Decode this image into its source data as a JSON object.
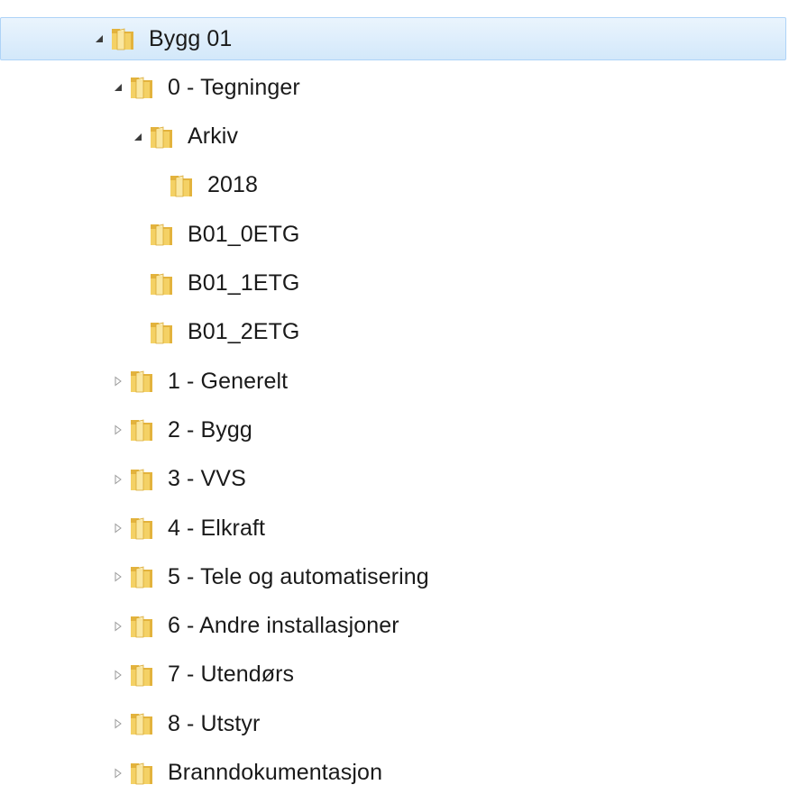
{
  "tree": {
    "items": [
      {
        "label": "Bygg 01",
        "depth": 0,
        "toggle": "expanded",
        "selected": true
      },
      {
        "label": "0 - Tegninger",
        "depth": 1,
        "toggle": "expanded",
        "selected": false
      },
      {
        "label": "Arkiv",
        "depth": 2,
        "toggle": "expanded",
        "selected": false
      },
      {
        "label": "2018",
        "depth": 3,
        "toggle": "none",
        "selected": false
      },
      {
        "label": "B01_0ETG",
        "depth": 2,
        "toggle": "none",
        "selected": false
      },
      {
        "label": "B01_1ETG",
        "depth": 2,
        "toggle": "none",
        "selected": false
      },
      {
        "label": "B01_2ETG",
        "depth": 2,
        "toggle": "none",
        "selected": false
      },
      {
        "label": "1 - Generelt",
        "depth": 1,
        "toggle": "collapsed",
        "selected": false
      },
      {
        "label": "2 - Bygg",
        "depth": 1,
        "toggle": "collapsed",
        "selected": false
      },
      {
        "label": "3 - VVS",
        "depth": 1,
        "toggle": "collapsed",
        "selected": false
      },
      {
        "label": "4 - Elkraft",
        "depth": 1,
        "toggle": "collapsed",
        "selected": false
      },
      {
        "label": "5 - Tele og automatisering",
        "depth": 1,
        "toggle": "collapsed",
        "selected": false
      },
      {
        "label": "6 - Andre installasjoner",
        "depth": 1,
        "toggle": "collapsed",
        "selected": false
      },
      {
        "label": "7 - Utendørs",
        "depth": 1,
        "toggle": "collapsed",
        "selected": false
      },
      {
        "label": "8 - Utstyr",
        "depth": 1,
        "toggle": "collapsed",
        "selected": false
      },
      {
        "label": "Branndokumentasjon",
        "depth": 1,
        "toggle": "collapsed",
        "selected": false
      }
    ]
  },
  "icons": {
    "folder": "folder-icon",
    "expanded": "triangle-expanded-icon",
    "collapsed": "triangle-collapsed-icon"
  },
  "colors": {
    "selection_top": "#eaf4fd",
    "selection_bottom": "#d3e8fa",
    "selection_border": "#aed3f7",
    "folder_front": "#f4d165",
    "folder_back": "#e3b33d",
    "text": "#1a1a1a"
  }
}
